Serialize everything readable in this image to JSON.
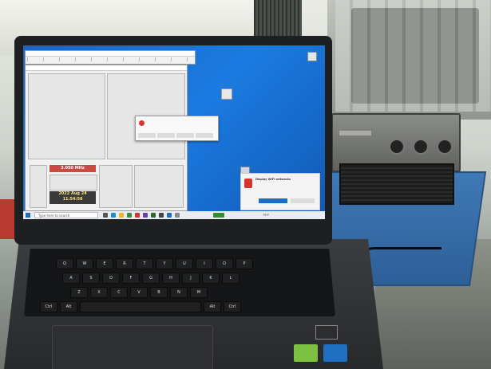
{
  "desktop": {
    "file_icon_label": "",
    "dialog_text": "",
    "dialog_buttons": [
      "",
      "",
      "",
      ""
    ],
    "toast_title": "Display WIFI networks",
    "toast_body": "",
    "toast_primary": "",
    "toast_secondary": ""
  },
  "app": {
    "frequency": "3.050 MHz",
    "clock_line1": "2022 Aug 24",
    "clock_line2": "11:54:58"
  },
  "taskbar": {
    "search_placeholder": "Type here to search",
    "tray_temp": "79°F"
  },
  "keyboard": {
    "row_labels": [
      "Q",
      "W",
      "E",
      "R",
      "T",
      "Y",
      "U",
      "I",
      "O",
      "P"
    ],
    "row2": [
      "A",
      "S",
      "D",
      "F",
      "G",
      "H",
      "J",
      "K",
      "L"
    ],
    "row3": [
      "Z",
      "X",
      "C",
      "V",
      "B",
      "N",
      "M"
    ],
    "mod_keys": [
      "Ctrl",
      "Alt",
      "Alt",
      "Ctrl"
    ]
  },
  "colors": {
    "desktop_blue": "#1b7be0",
    "frequency_red": "#c84a43",
    "table_blue": "#3f79b6",
    "sticker_green": "#7cc142",
    "sticker_blue": "#1f6fc2"
  }
}
